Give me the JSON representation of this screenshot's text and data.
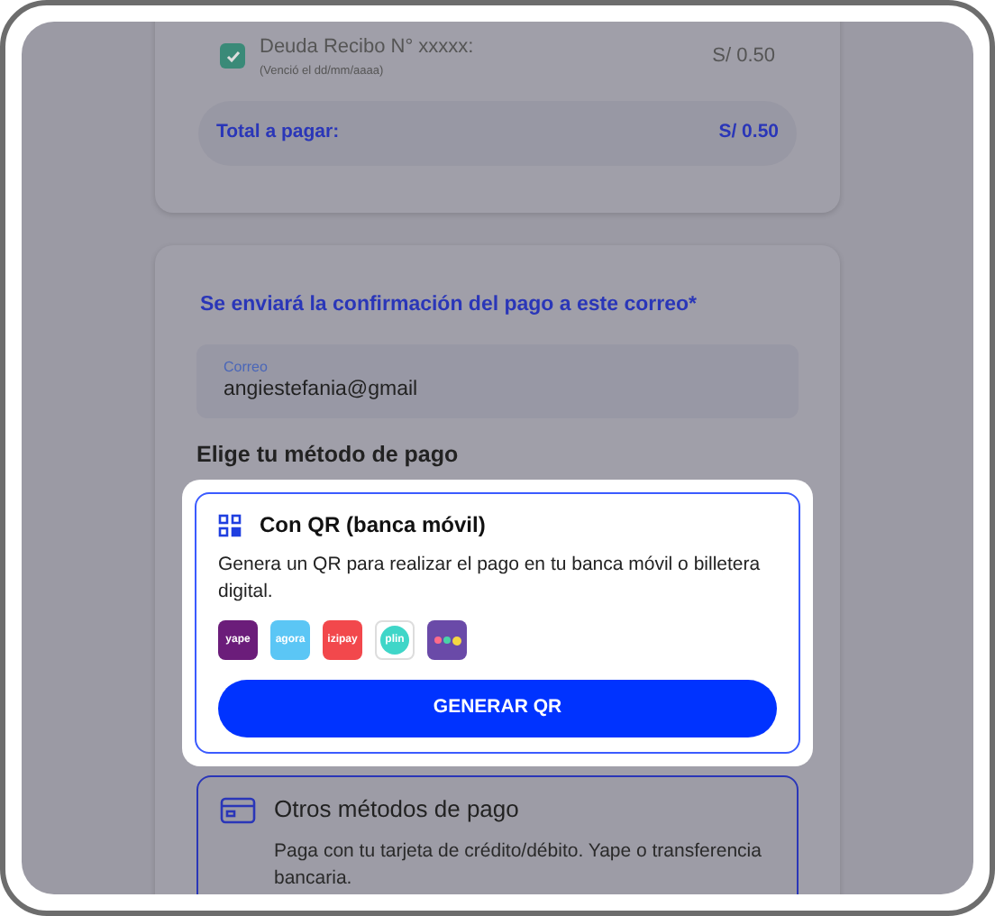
{
  "debt_item": {
    "checked": true,
    "title": "Deuda Recibo N° xxxxx:",
    "subtitle": "(Venció el dd/mm/aaaa)",
    "amount": "S/ 0.50"
  },
  "total": {
    "label": "Total a pagar:",
    "amount": "S/ 0.50"
  },
  "email_notice": "Se enviará la confirmación del pago a este correo*",
  "email_field": {
    "label": "Correo",
    "value": "angiestefania@gmail"
  },
  "method_heading": "Elige tu método de pago",
  "methods": [
    {
      "kind": "qr",
      "selected": true,
      "title": "Con QR (banca móvil)",
      "description": "Genera un QR para realizar el pago en tu banca móvil o billetera digital.",
      "wallets": [
        {
          "kind": "text",
          "label": "yape",
          "color": "#6b1d7a"
        },
        {
          "kind": "text",
          "label": "agora",
          "color": "#5bc6f5"
        },
        {
          "kind": "text",
          "label": "izipay",
          "color": "#f2484c"
        },
        {
          "kind": "bubble",
          "label": "plin",
          "color": "#3fd6c8"
        },
        {
          "kind": "dots",
          "color": "#6a4aa8"
        }
      ],
      "button": "GENERAR QR"
    },
    {
      "kind": "card",
      "selected": false,
      "title": "Otros métodos de pago",
      "description": "Paga con tu tarjeta de crédito/débito. Yape o transferencia bancaria."
    }
  ]
}
